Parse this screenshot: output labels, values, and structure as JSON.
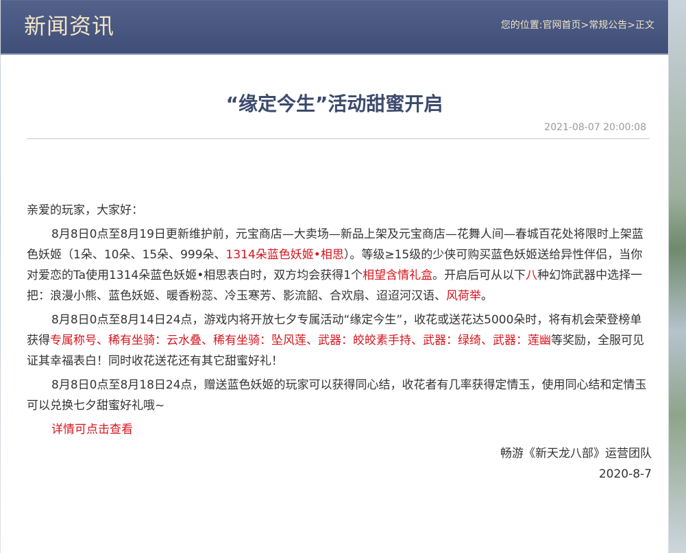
{
  "header": {
    "title": "新闻资讯",
    "breadcrumb_prefix": "您的位置:",
    "crumbs": [
      "官网首页",
      "常规公告",
      "正文"
    ],
    "separator": ">"
  },
  "article": {
    "title": "“缘定今生”活动甜蜜开启",
    "date": "2021-08-07 20:00:08",
    "greeting": "亲爱的玩家，大家好：",
    "p1": {
      "a": "8月8日0点至8月19日更新维护前，元宝商店—大卖场—新品上架及元宝商店—花舞人间—春城百花处将限时上架蓝色妖姬（1朵、10朵、15朵、999朵、",
      "r1": "1314朵蓝色妖姬•相思",
      "b": "）。等级≥15级的少侠可购买蓝色妖姬送给异性伴侣，当你对爱恋的Ta使用1314朵蓝色妖姬•相思表白时，双方均会获得1个",
      "r2": "相望含情礼盒",
      "c": "。开启后可从以下",
      "r3": "八",
      "d": "种幻饰武器中选择一把：浪漫小熊、蓝色妖姬、暖香粉蕊、冷玉寒芳、影流韶、合欢扇、迢迢河汉语、",
      "r4": "风荷举",
      "e": "。"
    },
    "p2": {
      "a": "8月8日0点至8月14日24点，游戏内将开放七夕专属活动“缘定今生”，收花或送花达5000朵时，将有机会荣登榜单获得",
      "r1": "专属称号、稀有坐骑：云水叠、稀有坐骑：坠风莲、武器：皎皎素手持、武器：绿绮、武器：莲幽",
      "b": "等奖励，全服可见证其幸福表白！同时收花送花还有其它甜蜜好礼！"
    },
    "p3": "8月8日0点至8月18日24点，赠送蓝色妖姬的玩家可以获得同心结，收花者有几率获得定情玉，使用同心结和定情玉可以兑换七夕甜蜜好礼哦~",
    "details_link": "详情可点击查看",
    "signature": "畅游《新天龙八部》运营团队",
    "sign_date": "2020-8-7"
  },
  "colors": {
    "header_bg": "#485780",
    "header_text": "#f3e6c8",
    "title_color": "#3c4a6d",
    "highlight_red": "#d8141c"
  }
}
